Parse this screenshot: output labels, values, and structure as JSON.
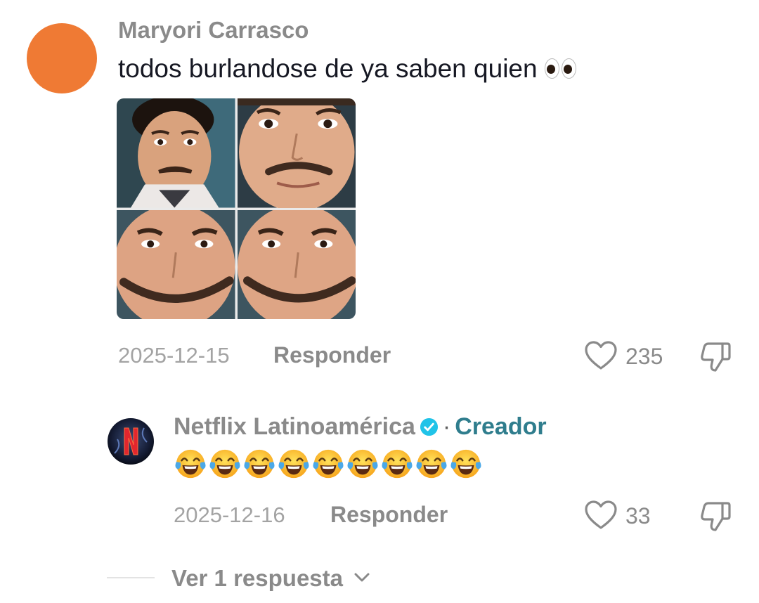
{
  "comment": {
    "username": "Maryori Carrasco",
    "text": "todos burlandose de ya saben quien",
    "text_emoji": "eyes-emoji",
    "avatar_color": "#EF7A34",
    "image": "meme-image",
    "date": "2025-12-15",
    "reply_label": "Responder",
    "like_icon": "heart-icon",
    "like_count": "235",
    "dislike_icon": "thumbs-down-icon"
  },
  "reply": {
    "username": "Netflix Latinoamérica",
    "verified_icon": "verified-badge-icon",
    "separator": "·",
    "creator_label": "Creador",
    "text_emoji": "face-with-tears-of-joy",
    "emoji_count": 9,
    "date": "2025-12-16",
    "reply_label": "Responder",
    "like_icon": "heart-icon",
    "like_count": "33",
    "dislike_icon": "thumbs-down-icon"
  },
  "view_replies": {
    "label": "Ver 1 respuesta",
    "icon": "chevron-down-icon"
  },
  "colors": {
    "username": "#8A8A8A",
    "text": "#161823",
    "creator": "#2F7D8D",
    "verified": "#20C3E8",
    "muted": "#A3A3A3"
  }
}
